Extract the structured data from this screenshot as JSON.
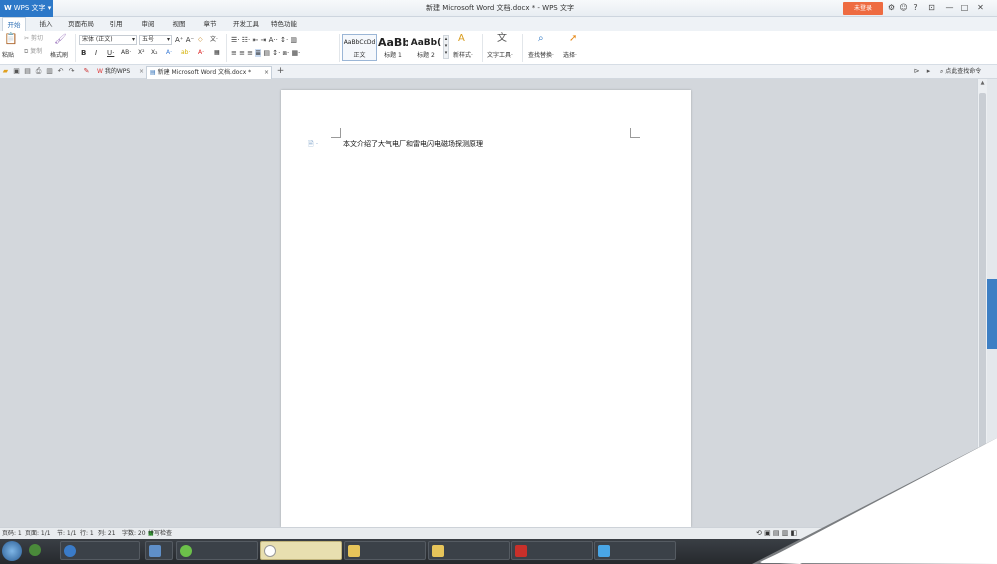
{
  "titlebar": {
    "app_label": "WPS 文字",
    "doc_title": "新建 Microsoft Word 文档.docx * - WPS 文字",
    "login_label": "未登录",
    "controls": [
      "?",
      "—",
      "□",
      "✕"
    ]
  },
  "menu": {
    "tabs": [
      "开始",
      "插入",
      "页面布局",
      "引用",
      "审阅",
      "视图",
      "章节",
      "开发工具",
      "特色功能"
    ],
    "active": "开始"
  },
  "ribbon": {
    "paste": "粘贴",
    "cut": "剪切",
    "copy": "复制",
    "format_painter": "格式刷",
    "font_name": "宋体 (正文)",
    "font_size": "五号",
    "styles": [
      {
        "sample": "AaBbCcDd",
        "name": "正文"
      },
      {
        "sample": "AaBb",
        "name": "标题 1"
      },
      {
        "sample": "AaBb(",
        "name": "标题 2"
      }
    ],
    "new_style": "新样式",
    "text_tools": "文字工具",
    "find_replace": "查找替换",
    "select": "选择"
  },
  "doc_tabs": {
    "tabs": [
      {
        "label": "我的WPS",
        "active": false
      },
      {
        "label": "新建 Microsoft Word 文档.docx *",
        "active": true
      }
    ],
    "search_hint": "点此查找命令"
  },
  "document": {
    "paragraph": "本文介绍了大气电厂和雷电闪电磁场探测原理"
  },
  "statusbar": {
    "page": "页码: 1",
    "pages": "页面: 1/1",
    "section": "节: 1/1",
    "row": "行: 1",
    "col": "列: 21",
    "words": "字数: 20",
    "spell": "拼写检查"
  },
  "colors": {
    "accent": "#2c78c8",
    "login": "#ee6b41",
    "workspace": "#d3d7dc"
  }
}
